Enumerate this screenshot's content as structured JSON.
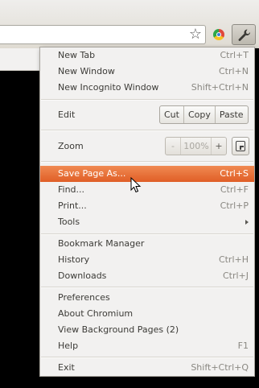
{
  "menu": {
    "items": [
      {
        "label": "New Tab",
        "shortcut": "Ctrl+T"
      },
      {
        "label": "New Window",
        "shortcut": "Ctrl+N"
      },
      {
        "label": "New Incognito Window",
        "shortcut": "Shift+Ctrl+N"
      },
      {
        "label": "Edit",
        "cut": "Cut",
        "copy": "Copy",
        "paste": "Paste"
      },
      {
        "label": "Zoom",
        "minus": "-",
        "value": "100%",
        "plus": "+"
      },
      {
        "label": "Save Page As...",
        "shortcut": "Ctrl+S"
      },
      {
        "label": "Find...",
        "shortcut": "Ctrl+F"
      },
      {
        "label": "Print...",
        "shortcut": "Ctrl+P"
      },
      {
        "label": "Tools"
      },
      {
        "label": "Bookmark Manager"
      },
      {
        "label": "History",
        "shortcut": "Ctrl+H"
      },
      {
        "label": "Downloads",
        "shortcut": "Ctrl+J"
      },
      {
        "label": "Preferences"
      },
      {
        "label": "About Chromium"
      },
      {
        "label": "View Background Pages (2)"
      },
      {
        "label": "Help",
        "shortcut": "F1"
      },
      {
        "label": "Exit",
        "shortcut": "Shift+Ctrl+Q"
      }
    ],
    "highlight_color": "#e8692f"
  },
  "toolbar": {
    "bookmark_icon": "star-icon",
    "extension_icon": "chromium-icon",
    "menu_icon": "wrench-icon"
  }
}
